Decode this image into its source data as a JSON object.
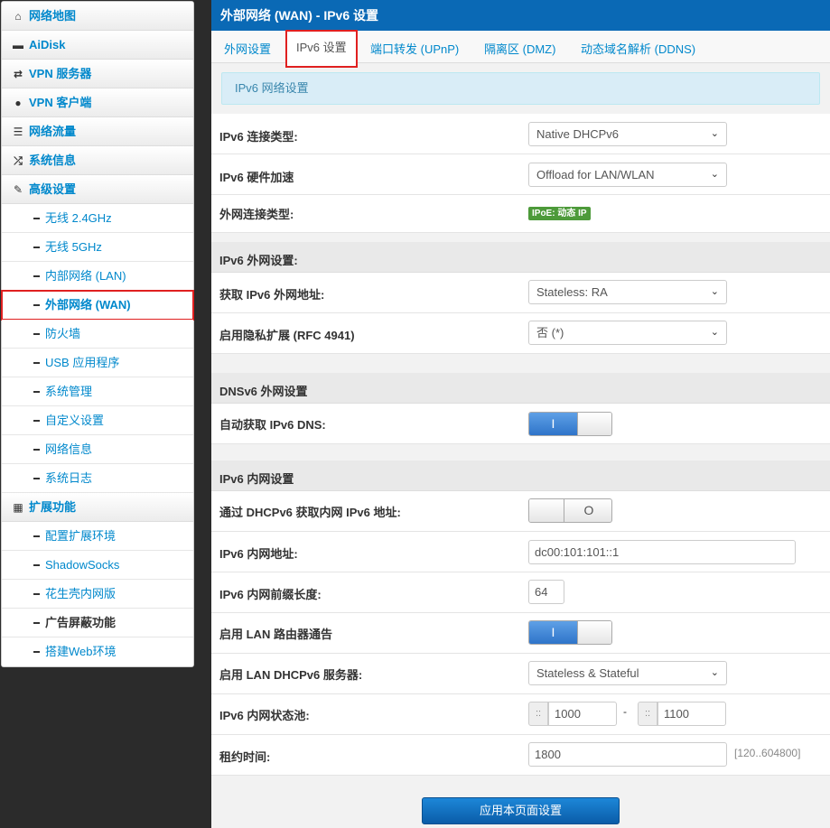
{
  "sidebar": {
    "items": [
      {
        "icon": "home-icon",
        "glyph": "⌂",
        "label": "网络地图"
      },
      {
        "icon": "hdd-icon",
        "glyph": "▬",
        "label": "AiDisk"
      },
      {
        "icon": "retweet-icon",
        "glyph": "⇄",
        "label": "VPN 服务器"
      },
      {
        "icon": "globe-icon",
        "glyph": "●",
        "label": "VPN 客户端"
      },
      {
        "icon": "list-icon",
        "glyph": "☰",
        "label": "网络流量"
      },
      {
        "icon": "random-icon",
        "glyph": "⤮",
        "label": "系统信息"
      },
      {
        "icon": "wrench-icon",
        "glyph": "✎",
        "label": "高级设置"
      }
    ],
    "advanced_sub": [
      "无线 2.4GHz",
      "无线 5GHz",
      "内部网络 (LAN)",
      "外部网络 (WAN)",
      "防火墙",
      "USB 应用程序",
      "系统管理",
      "自定义设置",
      "网络信息",
      "系统日志"
    ],
    "ext_header": {
      "icon": "grid-icon",
      "glyph": "▦",
      "label": "扩展功能"
    },
    "ext_sub": [
      "配置扩展环境",
      "ShadowSocks",
      "花生壳内网版",
      "广告屏蔽功能",
      "搭建Web环境"
    ]
  },
  "main": {
    "title": "外部网络 (WAN) - IPv6 设置",
    "tabs": [
      "外网设置",
      "IPv6 设置",
      "端口转发 (UPnP)",
      "隔离区 (DMZ)",
      "动态域名解析 (DDNS)"
    ],
    "info": "IPv6 网络设置",
    "conn_type_label": "IPv6 连接类型:",
    "conn_type_value": "Native DHCPv6",
    "hw_accel_label": "IPv6 硬件加速",
    "hw_accel_value": "Offload for LAN/WLAN",
    "wan_type_label": "外网连接类型:",
    "wan_type_badge": "IPoE: 动态 IP",
    "wan_section": "IPv6 外网设置:",
    "get_addr_label": "获取 IPv6 外网地址:",
    "get_addr_value": "Stateless: RA",
    "privacy_label": "启用隐私扩展 (RFC 4941)",
    "privacy_value": "否 (*)",
    "dns_section": "DNSv6 外网设置",
    "auto_dns_label": "自动获取 IPv6 DNS:",
    "auto_dns_on": "I",
    "lan_section": "IPv6 内网设置",
    "dhcp_lan_label": "通过 DHCPv6 获取内网 IPv6 地址:",
    "dhcp_lan_off": "O",
    "lan_addr_label": "IPv6 内网地址:",
    "lan_addr_value": "dc00:101:101::1",
    "prefix_label": "IPv6 内网前缀长度:",
    "prefix_value": "64",
    "ra_label": "启用 LAN 路由器通告",
    "ra_on": "I",
    "dhcp_server_label": "启用 LAN DHCPv6 服务器:",
    "dhcp_server_value": "Stateless & Stateful",
    "pool_label": "IPv6 内网状态池:",
    "pool_prefix": "::",
    "pool_start": "1000",
    "pool_sep": "-",
    "pool_end": "1100",
    "lease_label": "租约时间:",
    "lease_value": "1800",
    "lease_hint": "[120..604800]",
    "apply": "应用本页面设置",
    "chevron": "⌄"
  }
}
